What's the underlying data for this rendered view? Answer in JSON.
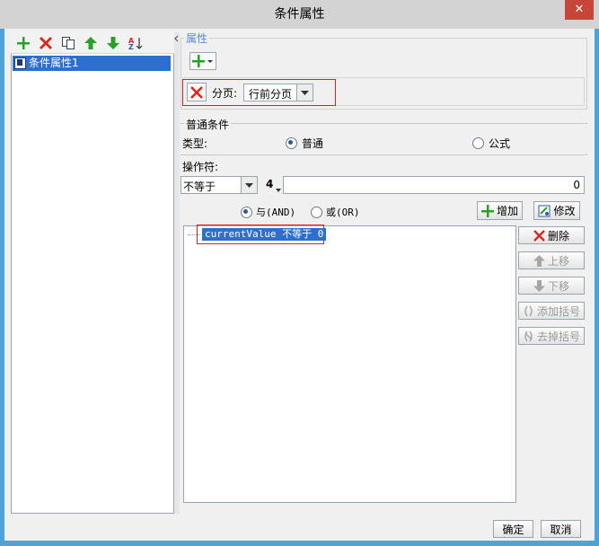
{
  "window": {
    "title": "条件属性",
    "close_glyph": "✕"
  },
  "left_panel": {
    "toolbar_icons": [
      "add-icon",
      "delete-icon",
      "copy-icon",
      "move-up-icon",
      "move-down-icon",
      "sort-icon"
    ],
    "items": [
      {
        "label": "条件属性1"
      }
    ]
  },
  "properties": {
    "legend": "属性",
    "pagination_label": "分页:",
    "pagination_value": "行前分页"
  },
  "condition": {
    "legend": "普通条件",
    "type_label": "类型:",
    "type_options": [
      "普通",
      "公式"
    ],
    "type_selected": "普通",
    "operator_label": "操作符:",
    "operator_value": "不等于",
    "value_type_glyph": "4",
    "value_input": "0",
    "logic_options": [
      "与(AND)",
      "或(OR)"
    ],
    "logic_selected": "与(AND)",
    "add_button": "增加",
    "modify_button": "修改"
  },
  "condition_list": {
    "items": [
      {
        "text": "currentValue 不等于 0",
        "selected": true
      }
    ]
  },
  "side_buttons": {
    "delete": "删除",
    "move_up": "上移",
    "move_down": "下移",
    "add_bracket": "添加括号",
    "remove_bracket": "去掉括号"
  },
  "footer": {
    "ok": "确定",
    "cancel": "取消"
  },
  "colors": {
    "selection": "#2d6fcf",
    "highlight_border": "#e02020",
    "accent_green": "#2aa02a",
    "delete_red": "#d9261c"
  }
}
